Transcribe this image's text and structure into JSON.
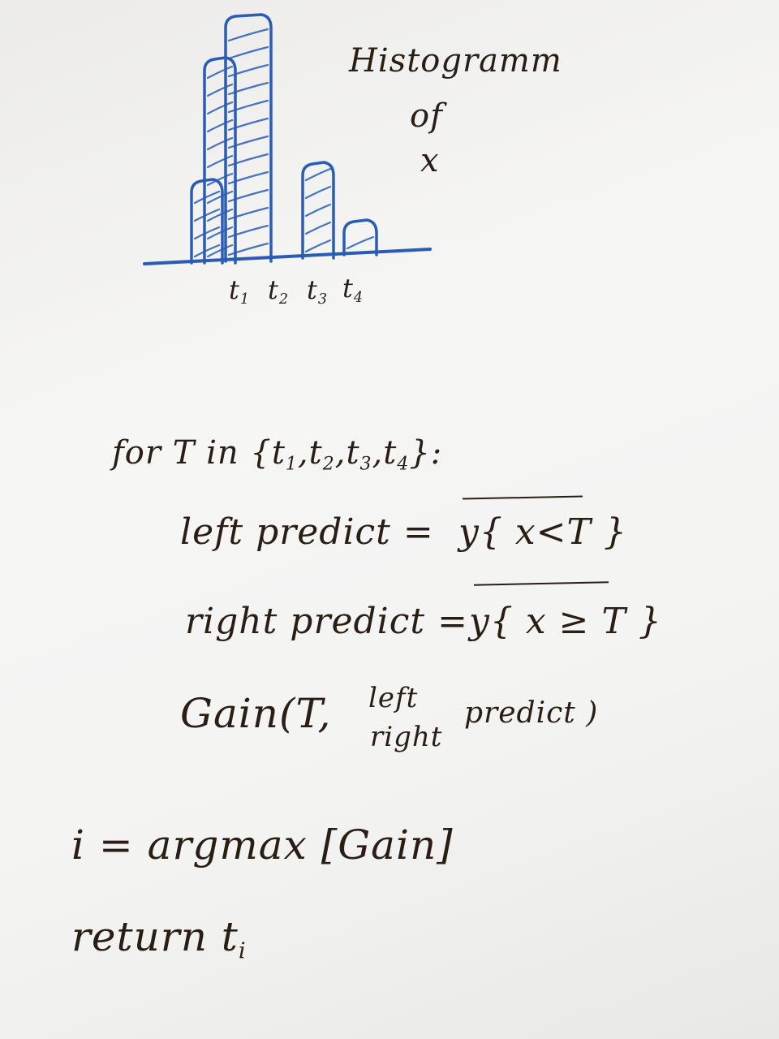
{
  "histogram": {
    "title_lines": [
      "Histogramm",
      "of",
      "x"
    ],
    "tick_labels": [
      "t",
      "t",
      "t",
      "t"
    ],
    "tick_subscripts": [
      "1",
      "2",
      "3",
      "4"
    ],
    "bar_heights_relative": [
      0.33,
      0.83,
      1.0,
      0.38,
      0.13
    ],
    "stroke_color": "#2a5cb5"
  },
  "algorithm": {
    "loop_prefix": "for  T  in {",
    "loop_items": [
      "t",
      "t",
      "t",
      "t"
    ],
    "loop_subscripts": [
      "1",
      "2",
      "3",
      "4"
    ],
    "loop_suffix": "}:",
    "left_label": "left predict  =",
    "left_expr": "y{ x<T }",
    "right_label": "right predict =",
    "right_expr": "y{ x ≥ T }",
    "gain_prefix": "Gain(T,",
    "gain_top": "left",
    "gain_bottom": "right",
    "gain_suffix": "predict )",
    "argmax_line": "i = argmax [Gain]",
    "return_prefix": "return t",
    "return_subscript": "i",
    "ink_color": "#2a1e14"
  }
}
